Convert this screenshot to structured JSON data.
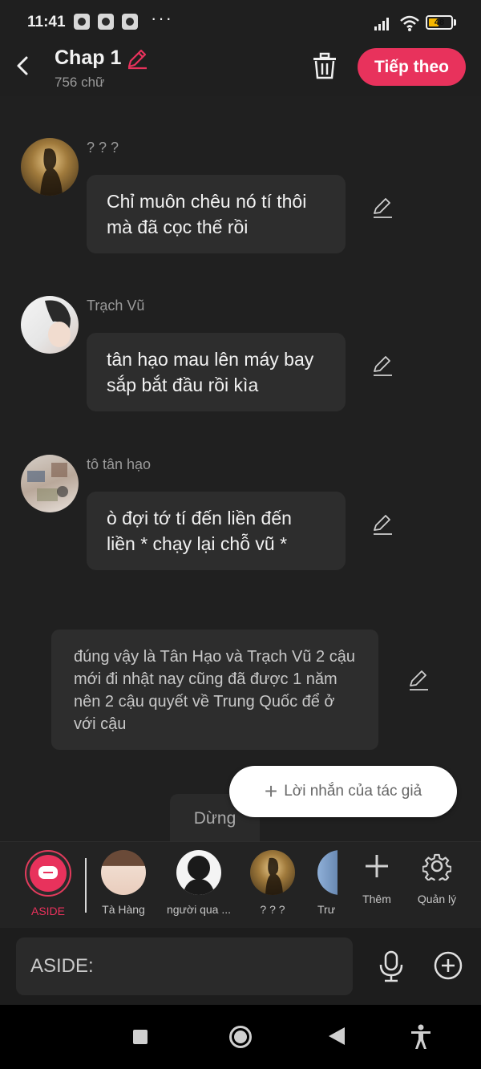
{
  "status_bar": {
    "time": "11:41",
    "battery": "48",
    "battery_level": 0.48
  },
  "header": {
    "title": "Chap 1",
    "word_count": "756 chữ",
    "next_label": "Tiếp theo"
  },
  "messages": [
    {
      "name": "? ? ?",
      "text": "Chỉ muôn chêu nó tí thôi mà đã cọc thế rồi"
    },
    {
      "name": "Trạch Vũ",
      "text": "tân hạo mau lên máy bay sắp bắt đầu rồi kìa"
    },
    {
      "name": "tô tân hạo",
      "text": "ò đợi tớ tí đến liền đến liền * chạy lại chỗ vũ *"
    }
  ],
  "narration": {
    "text": "đúng vậy là Tân Hạo và Trạch Vũ 2 cậu mới đi nhật nay cũng đã được 1 năm nên 2 cậu quyết về Trung Quốc để ở với cậu"
  },
  "controls": {
    "pause_label": "Dừng",
    "author_note_label": "Lời nhắn của tác giả"
  },
  "characters": [
    {
      "name": "ASIDE"
    },
    {
      "name": "Tà Hàng"
    },
    {
      "name": "người qua ..."
    },
    {
      "name": "? ? ?"
    },
    {
      "name": "Trư"
    }
  ],
  "tools": {
    "add_label": "Thêm",
    "manage_label": "Quản lý"
  },
  "input": {
    "placeholder": "ASIDE:"
  },
  "colors": {
    "accent": "#e8325c",
    "background": "#202020",
    "bubble": "#2d2d2d"
  }
}
